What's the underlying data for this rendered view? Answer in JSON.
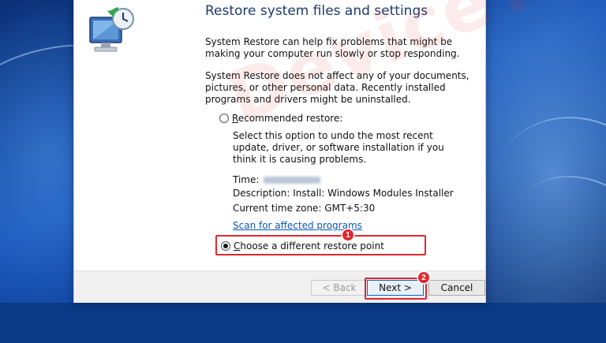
{
  "dialog": {
    "title": "Restore system files and settings",
    "para1": "System Restore can help fix problems that might be making your computer run slowly or stop responding.",
    "para2": "System Restore does not affect any of your documents, pictures, or other personal data. Recently installed programs and drivers might be uninstalled.",
    "recommended": {
      "label_prefix": "R",
      "label_rest": "ecommended restore:",
      "description": "Select this option to undo the most recent update, driver, or software installation if you think it is causing problems.",
      "selected": false
    },
    "info": {
      "time_label": "Time:",
      "description": "Description: Install: Windows Modules Installer",
      "timezone": "Current time zone: GMT+5:30"
    },
    "scan_link": "Scan for affected programs",
    "choose": {
      "label_prefix": "C",
      "label_rest": "hoose a different restore point",
      "selected": true
    }
  },
  "footer": {
    "back_label": "< Back",
    "next_label": "Next >",
    "cancel_label": "Cancel"
  },
  "annotations": {
    "badge1": "1",
    "badge2": "2"
  },
  "watermark": "DeviceTricks",
  "colors": {
    "highlight": "#e0272f",
    "link": "#0a56b4",
    "title": "#1e3a6e"
  }
}
